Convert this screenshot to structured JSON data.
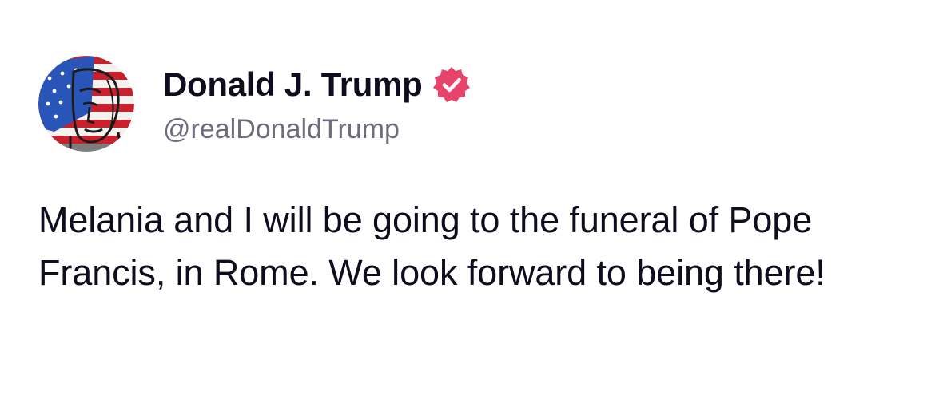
{
  "author": {
    "display_name": "Donald J. Trump",
    "handle": "@realDonaldTrump",
    "verified": true,
    "avatar_icon": "flag-portrait-avatar",
    "verified_icon": "verified-badge-icon"
  },
  "post": {
    "text": "Melania and I will be going to the funeral of Pope Francis, in Rome. We look forward to being there!"
  },
  "colors": {
    "text": "#0d0d1e",
    "handle": "#6e6d80",
    "verified_badge": "#e8436a",
    "background": "#ffffff"
  }
}
